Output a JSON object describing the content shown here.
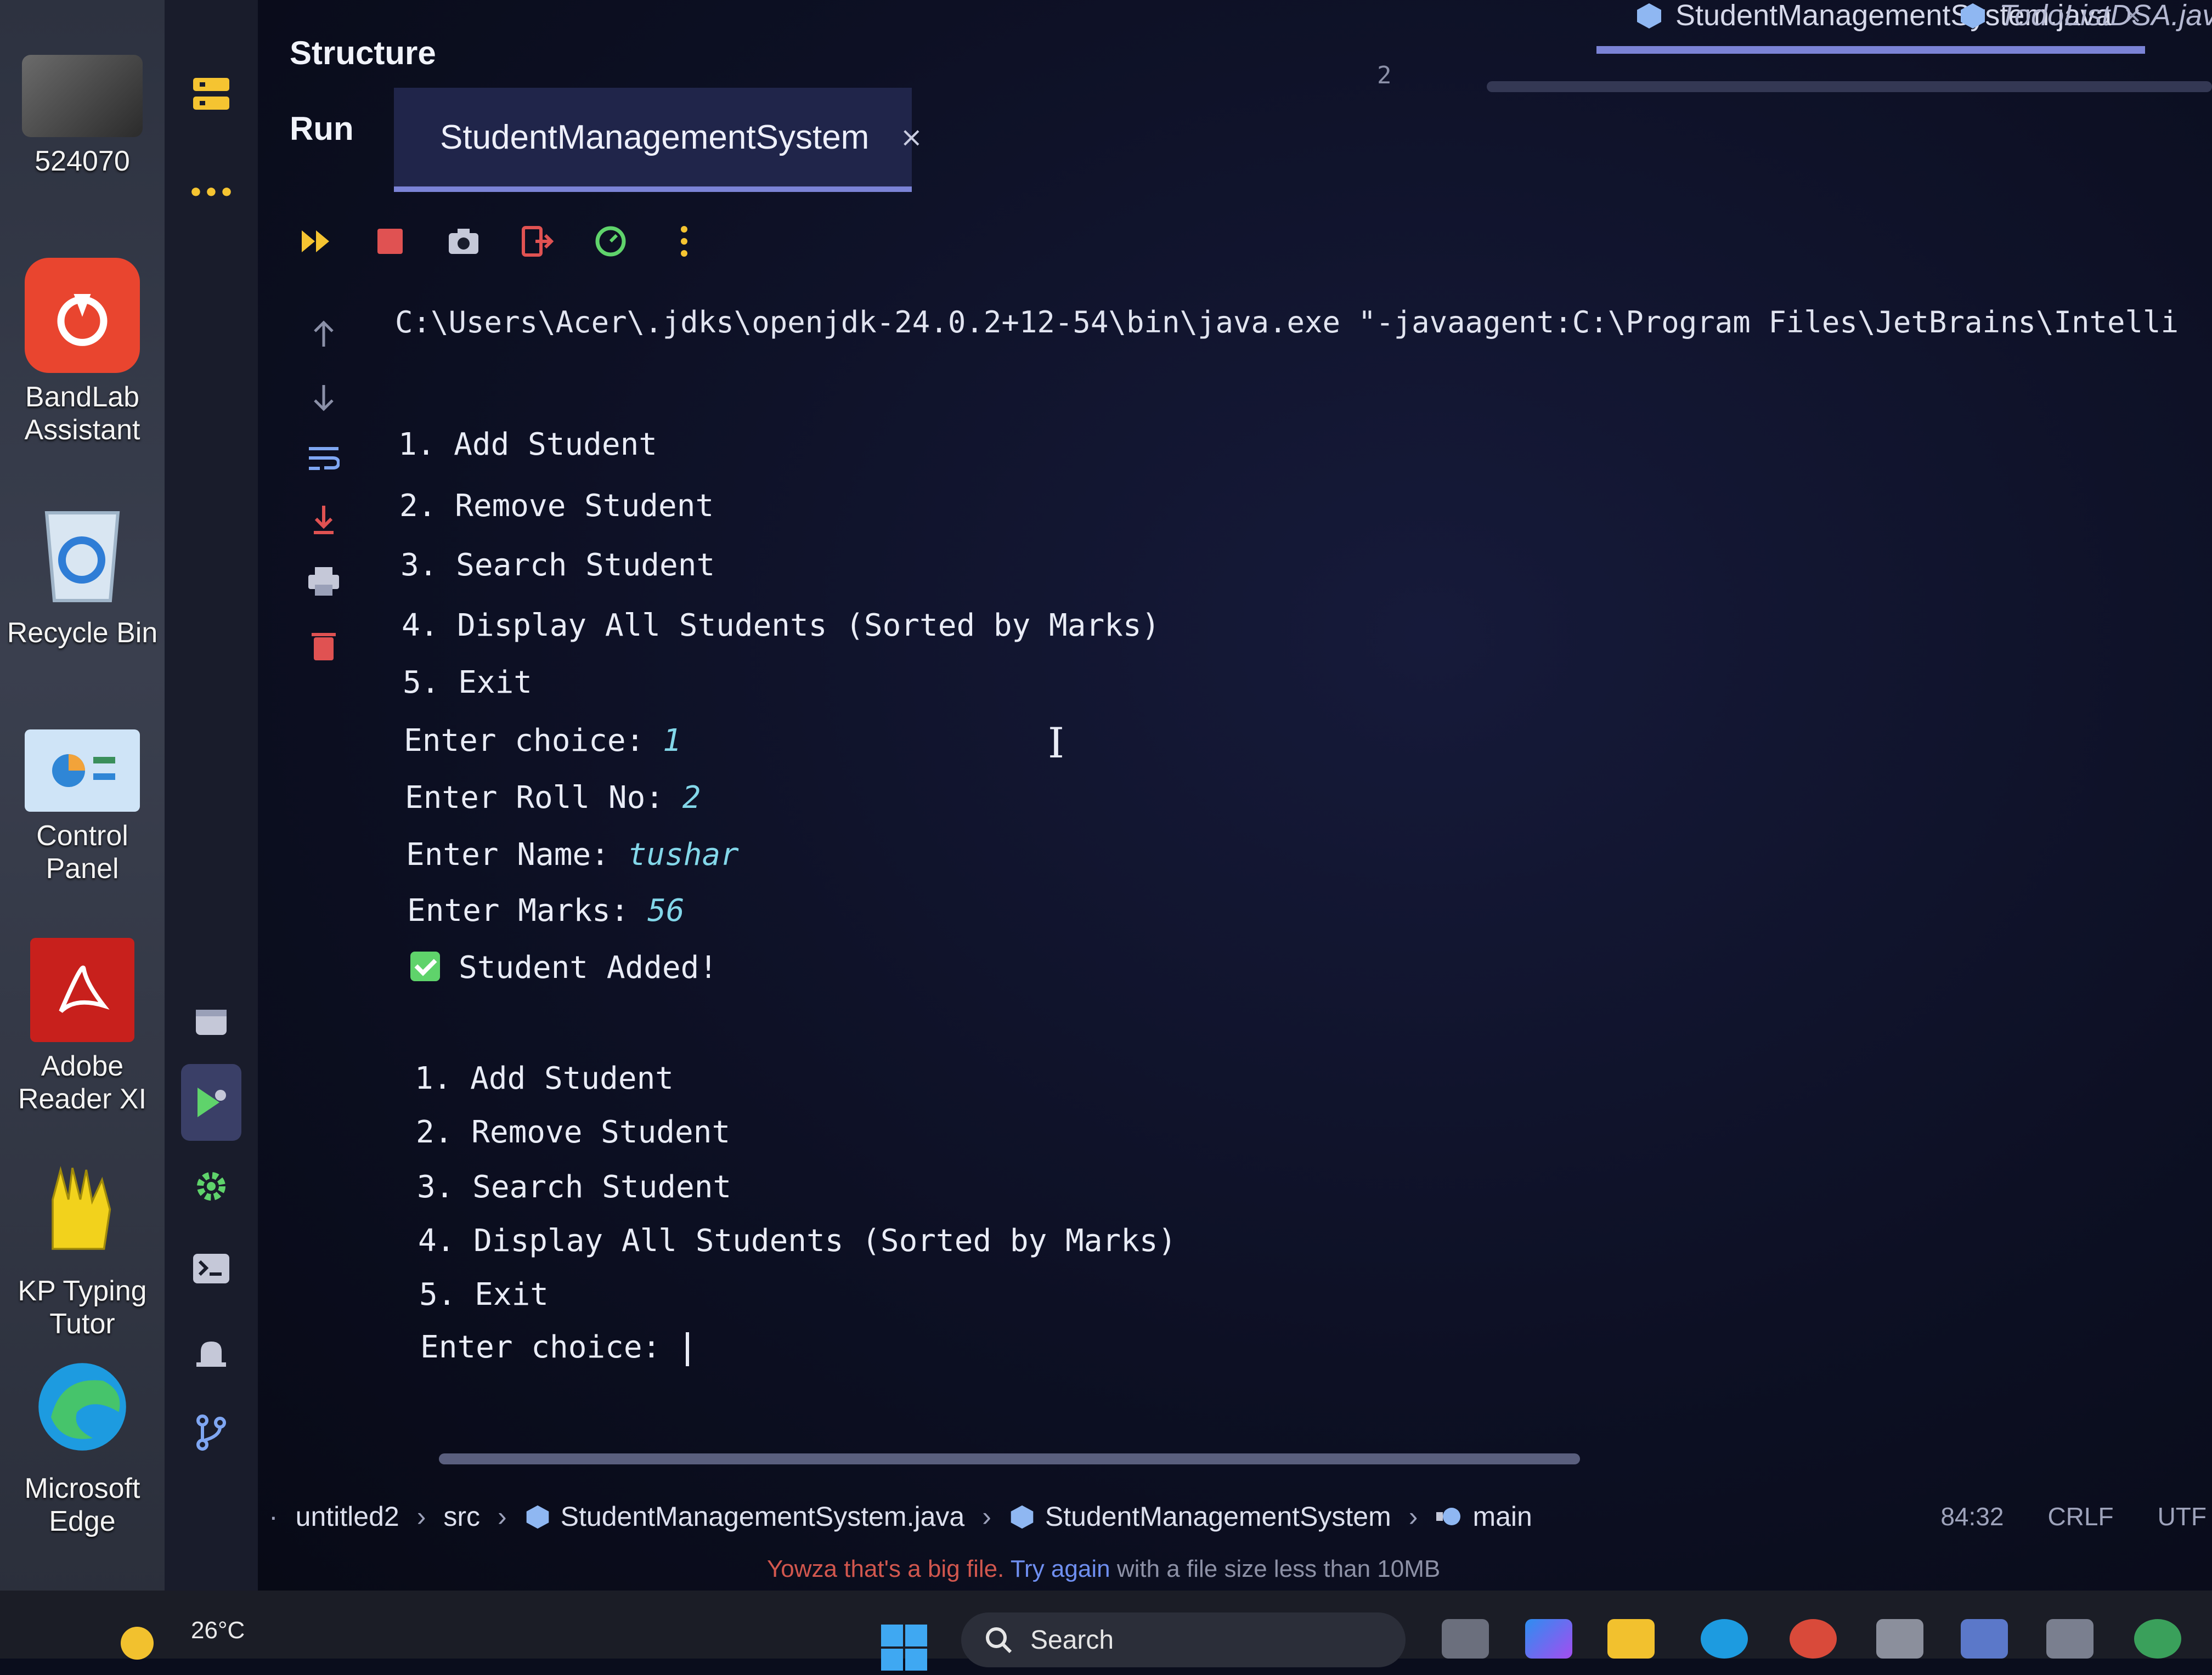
{
  "desktop": {
    "icons": [
      {
        "label": "524070",
        "icon": "photo-group-icon"
      },
      {
        "label": "BandLab Assistant",
        "icon": "bandlab-icon"
      },
      {
        "label": "Recycle Bin",
        "icon": "recycle-bin-icon"
      },
      {
        "label": "Control Panel",
        "icon": "control-panel-icon"
      },
      {
        "label": "Adobe Reader XI",
        "icon": "adobe-reader-icon"
      },
      {
        "label": "KP Typing Tutor",
        "icon": "kp-typing-icon"
      },
      {
        "label": "Microsoft Edge",
        "icon": "edge-icon"
      }
    ]
  },
  "ide": {
    "structure_title": "Structure",
    "run_title": "Run",
    "editor_tabs": [
      "StudentManagementSystem.java",
      "TodoListDSA.java"
    ],
    "editor_gutter_line": "2",
    "run_tab": {
      "label": "StudentManagementSystem",
      "close": "×"
    },
    "more_dots": "•••",
    "console": {
      "command": "C:\\Users\\Acer\\.jdks\\openjdk-24.0.2+12-54\\bin\\java.exe \"-javaagent:C:\\Program Files\\JetBrains\\Intelli",
      "menu1": [
        "1. Add Student",
        "2. Remove Student",
        "3. Search Student",
        "4. Display All Students (Sorted by Marks)",
        "5. Exit"
      ],
      "prompt_choice": "Enter choice: ",
      "input_choice": "1",
      "prompt_roll": "Enter Roll No: ",
      "input_roll": "2",
      "prompt_name": "Enter Name: ",
      "input_name": "tushar",
      "prompt_marks": "Enter Marks: ",
      "input_marks": "56",
      "added_msg": "Student Added!",
      "menu2": [
        "1. Add Student",
        "2. Remove Student",
        "3. Search Student",
        "4. Display All Students (Sorted by Marks)",
        "5. Exit"
      ],
      "final_prompt": "Enter choice: "
    },
    "breadcrumb": [
      "untitled2",
      "src",
      "StudentManagementSystem.java",
      "StudentManagementSystem",
      "main"
    ],
    "status": {
      "position": "84:32",
      "line_ending": "CRLF",
      "encoding": "UTF"
    },
    "notification": {
      "error": "Yowza that's a big file.",
      "link": "Try again",
      "rest": "with a file size less than 10MB"
    }
  },
  "taskbar": {
    "weather": "26°C",
    "search_label": "Search"
  },
  "colors": {
    "accent": "#7b83d6",
    "console_input": "#83d7e9",
    "success": "#5fd36b",
    "stop_red": "#e05252",
    "error_text": "#d2574e"
  }
}
